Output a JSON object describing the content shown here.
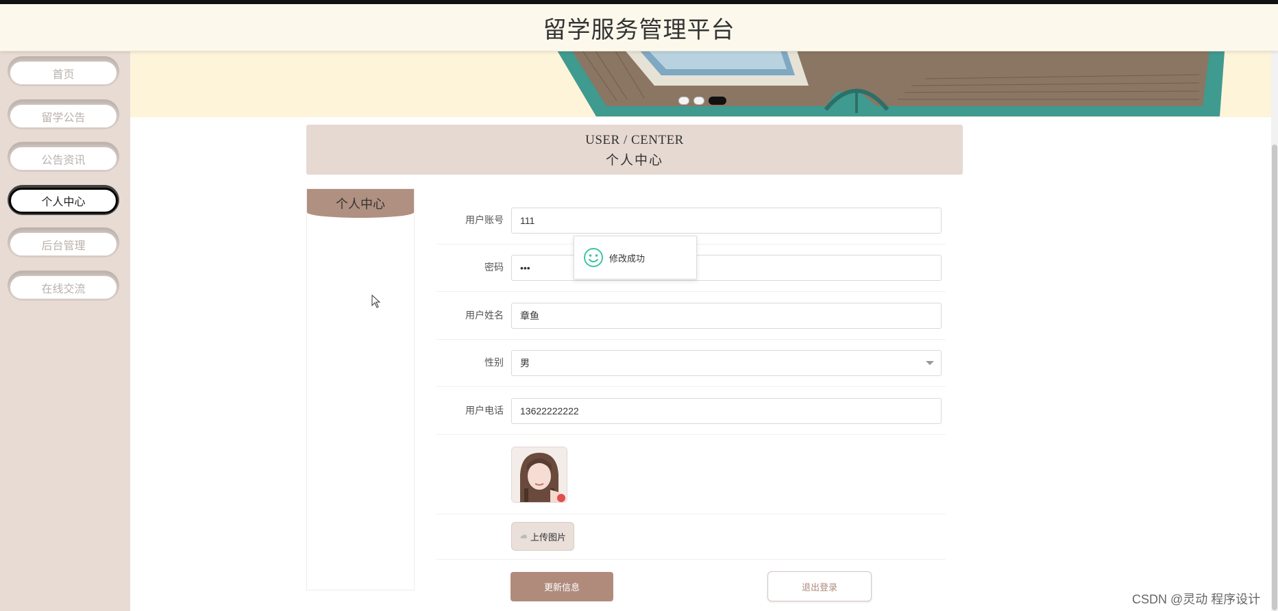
{
  "header": {
    "title": "留学服务管理平台"
  },
  "sidebar": {
    "items": [
      {
        "label": "首页",
        "active": false
      },
      {
        "label": "留学公告",
        "active": false
      },
      {
        "label": "公告资讯",
        "active": false
      },
      {
        "label": "个人中心",
        "active": true
      },
      {
        "label": "后台管理",
        "active": false
      },
      {
        "label": "在线交流",
        "active": false
      }
    ]
  },
  "banner": {
    "slide_count": 3,
    "active_slide": 3
  },
  "section": {
    "title_en": "USER / CENTER",
    "title_zh": "个人中心"
  },
  "left_panel": {
    "tab_label": "个人中心"
  },
  "form": {
    "account": {
      "label": "用户账号",
      "value": "111"
    },
    "password": {
      "label": "密码",
      "value": "•••"
    },
    "name": {
      "label": "用户姓名",
      "value": "章鱼"
    },
    "gender": {
      "label": "性别",
      "value": "男"
    },
    "phone": {
      "label": "用户电话",
      "value": "13622222222"
    },
    "upload_label": "上传图片",
    "update_label": "更新信息",
    "logout_label": "退出登录"
  },
  "toast": {
    "message": "修改成功"
  },
  "watermark": "CSDN @灵动 程序设计",
  "colors": {
    "accent": "#b08b7c",
    "sidebar_bg": "#e8dbd3",
    "header_bg": "#fdf8ec",
    "toast_icon": "#3cc4a0"
  }
}
